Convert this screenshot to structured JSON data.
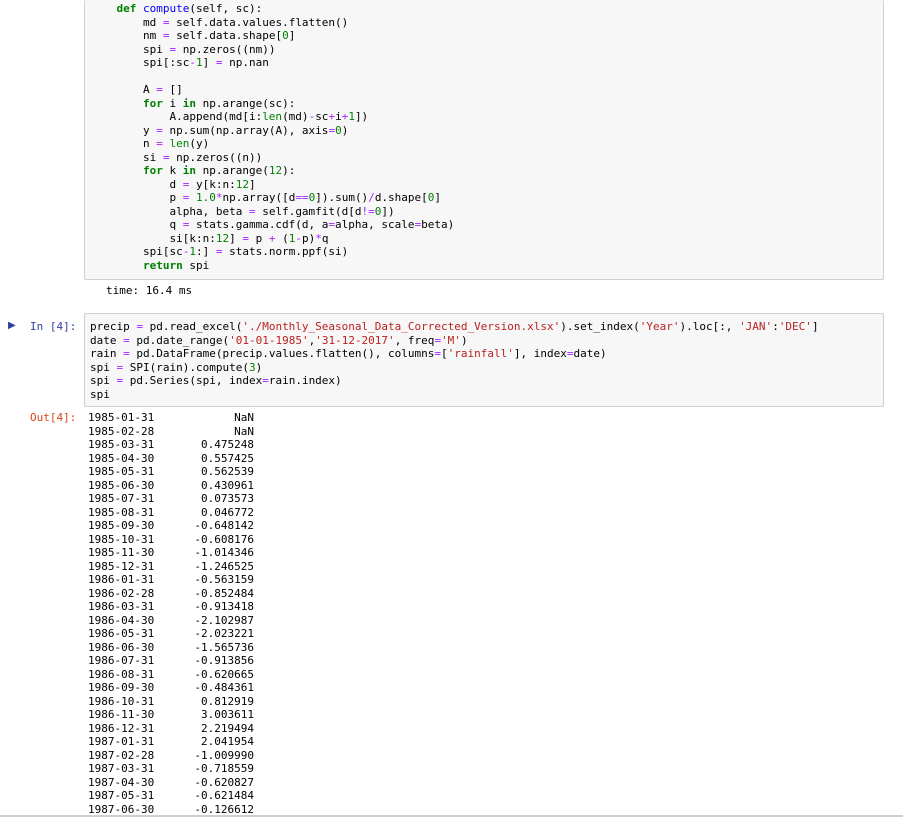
{
  "cell1": {
    "code_lines": [
      "    def compute(self, sc):",
      "        md = self.data.values.flatten()",
      "        nm = self.data.shape[0]",
      "        spi = np.zeros((nm))",
      "        spi[:sc-1] = np.nan",
      "",
      "        A = []",
      "        for i in np.arange(sc):",
      "            A.append(md[i:len(md)-sc+i+1])",
      "        y = np.sum(np.array(A), axis=0)",
      "        n = len(y)",
      "        si = np.zeros((n))",
      "        for k in np.arange(12):",
      "            d = y[k:n:12]",
      "            p = 1.0*np.array([d==0]).sum()/d.shape[0]",
      "            alpha, beta = self.gamfit(d[d!=0])",
      "            q = stats.gamma.cdf(d, a=alpha, scale=beta)",
      "            si[k:n:12] = p + (1-p)*q",
      "        spi[sc-1:] = stats.norm.ppf(si)",
      "        return spi"
    ],
    "time_output": "time: 16.4 ms"
  },
  "cell2": {
    "in_prompt": "In [4]:",
    "out_prompt": "Out[4]:",
    "code_lines": [
      "precip = pd.read_excel('./Monthly_Seasonal_Data_Corrected_Version.xlsx').set_index('Year').loc[:, 'JAN':'DEC']",
      "date = pd.date_range('01-01-1985','31-12-2017', freq='M')",
      "rain = pd.DataFrame(precip.values.flatten(), columns=['rainfall'], index=date)",
      "spi = SPI(rain).compute(3)",
      "spi = pd.Series(spi, index=rain.index)",
      "spi"
    ],
    "output_rows": [
      {
        "date": "1985-01-31",
        "value": "NaN"
      },
      {
        "date": "1985-02-28",
        "value": "NaN"
      },
      {
        "date": "1985-03-31",
        "value": "0.475248"
      },
      {
        "date": "1985-04-30",
        "value": "0.557425"
      },
      {
        "date": "1985-05-31",
        "value": "0.562539"
      },
      {
        "date": "1985-06-30",
        "value": "0.430961"
      },
      {
        "date": "1985-07-31",
        "value": "0.073573"
      },
      {
        "date": "1985-08-31",
        "value": "0.046772"
      },
      {
        "date": "1985-09-30",
        "value": "-0.648142"
      },
      {
        "date": "1985-10-31",
        "value": "-0.608176"
      },
      {
        "date": "1985-11-30",
        "value": "-1.014346"
      },
      {
        "date": "1985-12-31",
        "value": "-1.246525"
      },
      {
        "date": "1986-01-31",
        "value": "-0.563159"
      },
      {
        "date": "1986-02-28",
        "value": "-0.852484"
      },
      {
        "date": "1986-03-31",
        "value": "-0.913418"
      },
      {
        "date": "1986-04-30",
        "value": "-2.102987"
      },
      {
        "date": "1986-05-31",
        "value": "-2.023221"
      },
      {
        "date": "1986-06-30",
        "value": "-1.565736"
      },
      {
        "date": "1986-07-31",
        "value": "-0.913856"
      },
      {
        "date": "1986-08-31",
        "value": "-0.620665"
      },
      {
        "date": "1986-09-30",
        "value": "-0.484361"
      },
      {
        "date": "1986-10-31",
        "value": "0.812919"
      },
      {
        "date": "1986-11-30",
        "value": "3.003611"
      },
      {
        "date": "1986-12-31",
        "value": "2.219494"
      },
      {
        "date": "1987-01-31",
        "value": "2.041954"
      },
      {
        "date": "1987-02-28",
        "value": "-1.009990"
      },
      {
        "date": "1987-03-31",
        "value": "-0.718559"
      },
      {
        "date": "1987-04-30",
        "value": "-0.620827"
      },
      {
        "date": "1987-05-31",
        "value": "-0.621484"
      },
      {
        "date": "1987-06-30",
        "value": "-0.126612"
      }
    ]
  },
  "icons": {
    "run": "run-cell-icon"
  },
  "colors": {
    "in_prompt": "#303f9f",
    "out_prompt": "#d84315",
    "keyword": "#008000",
    "string": "#ba2121",
    "operator": "#aa22ff",
    "cell_bg": "#f7f7f7",
    "cell_border": "#cfcfcf"
  }
}
